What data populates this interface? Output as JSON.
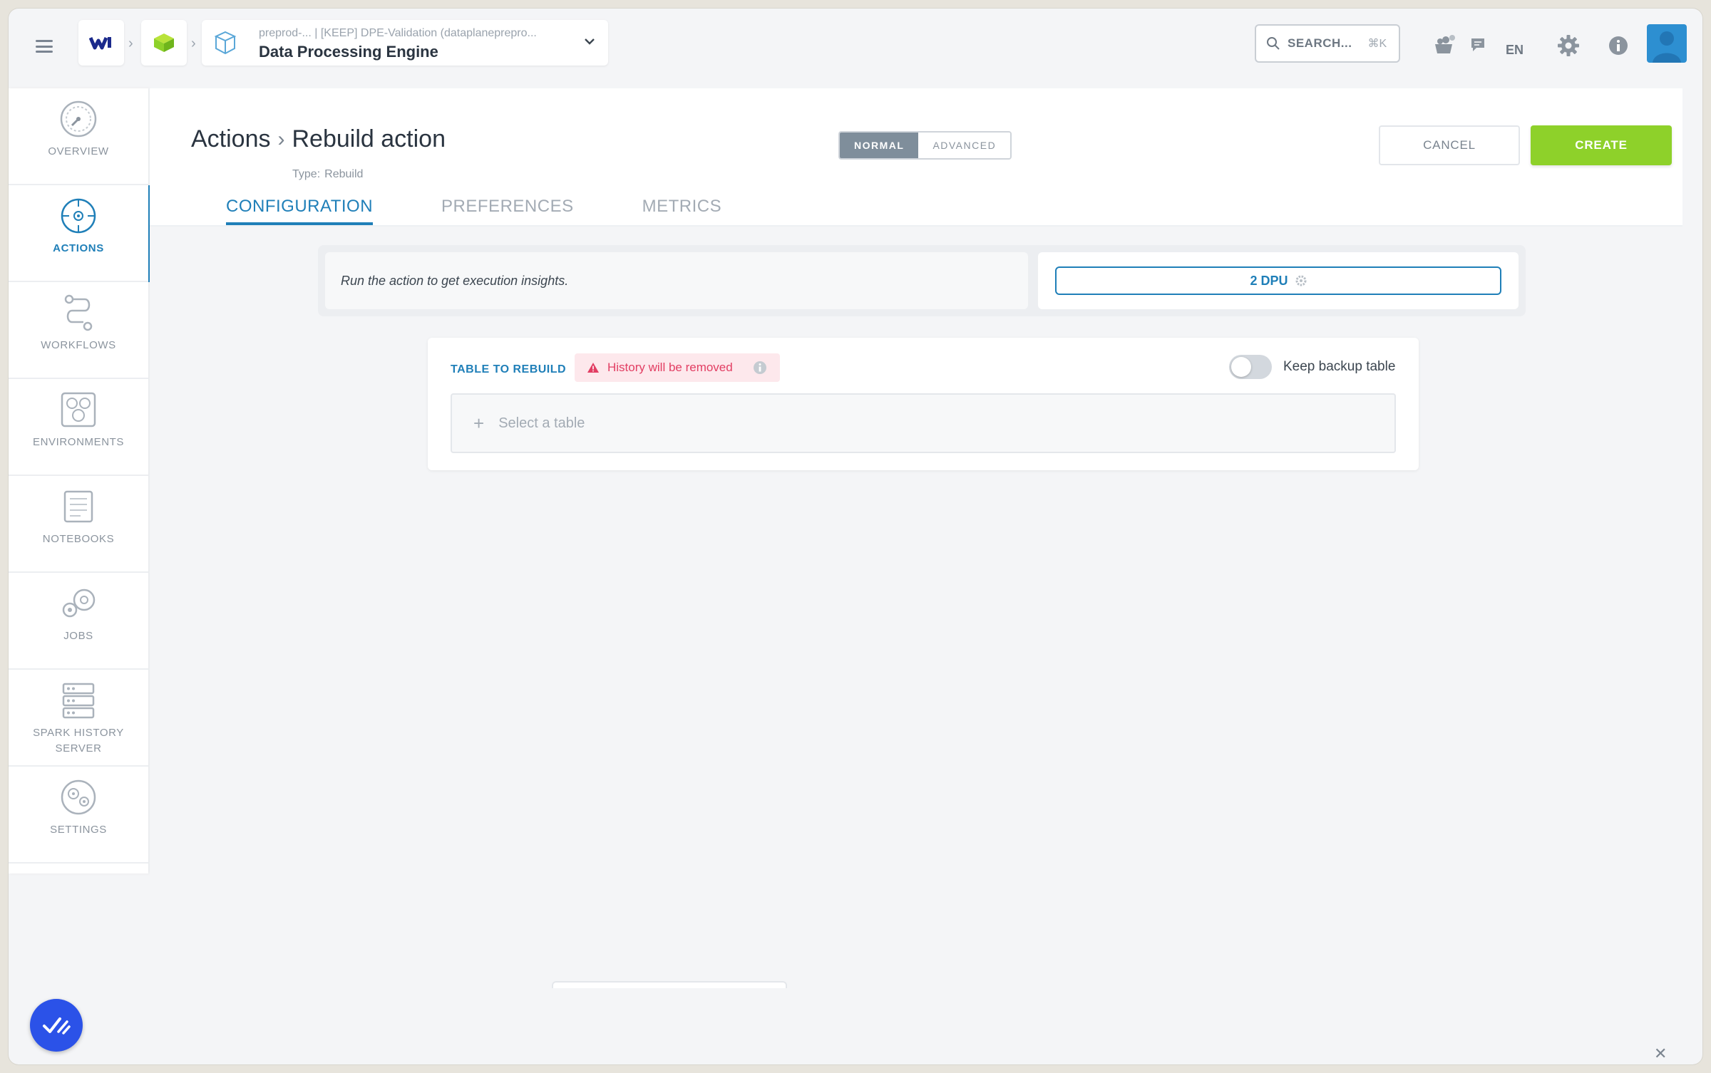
{
  "topbar": {
    "project_sub": "preprod-...  | [KEEP] DPE-Validation (dataplaneprepro...",
    "project_title": "Data Processing Engine",
    "search_label": "SEARCH...",
    "search_kbd": "⌘K",
    "language": "EN"
  },
  "sidebar": {
    "items": [
      {
        "label": "OVERVIEW",
        "icon": "gauge-icon"
      },
      {
        "label": "ACTIONS",
        "icon": "target-icon",
        "active": true
      },
      {
        "label": "WORKFLOWS",
        "icon": "workflow-icon"
      },
      {
        "label": "ENVIRONMENTS",
        "icon": "environments-icon"
      },
      {
        "label": "NOTEBOOKS",
        "icon": "notebook-icon"
      },
      {
        "label": "JOBS",
        "icon": "jobs-icon"
      },
      {
        "label": "SPARK HISTORY SERVER",
        "icon": "server-icon"
      },
      {
        "label": "SETTINGS",
        "icon": "settings-icon"
      }
    ]
  },
  "header": {
    "breadcrumb_root": "Actions",
    "breadcrumb_current": "Rebuild action",
    "type_label": "Type:",
    "type_value": "Rebuild",
    "mode_normal": "NORMAL",
    "mode_advanced": "ADVANCED",
    "cancel_label": "CANCEL",
    "create_label": "CREATE"
  },
  "tabs": [
    {
      "label": "CONFIGURATION",
      "active": true
    },
    {
      "label": "PREFERENCES",
      "active": false
    },
    {
      "label": "METRICS",
      "active": false
    }
  ],
  "insight": {
    "text": "Run the action to get execution insights.",
    "dpu_label": "2 DPU"
  },
  "rebuild": {
    "section_label": "TABLE TO REBUILD",
    "warning": "History will be removed",
    "toggle_label": "Keep backup table",
    "toggle_on": false,
    "select_placeholder": "Select a table"
  },
  "colors": {
    "accent": "#1f7fb8",
    "create": "#8ed12a",
    "warning_text": "#e23e63",
    "warning_bg": "#fde8ec"
  }
}
